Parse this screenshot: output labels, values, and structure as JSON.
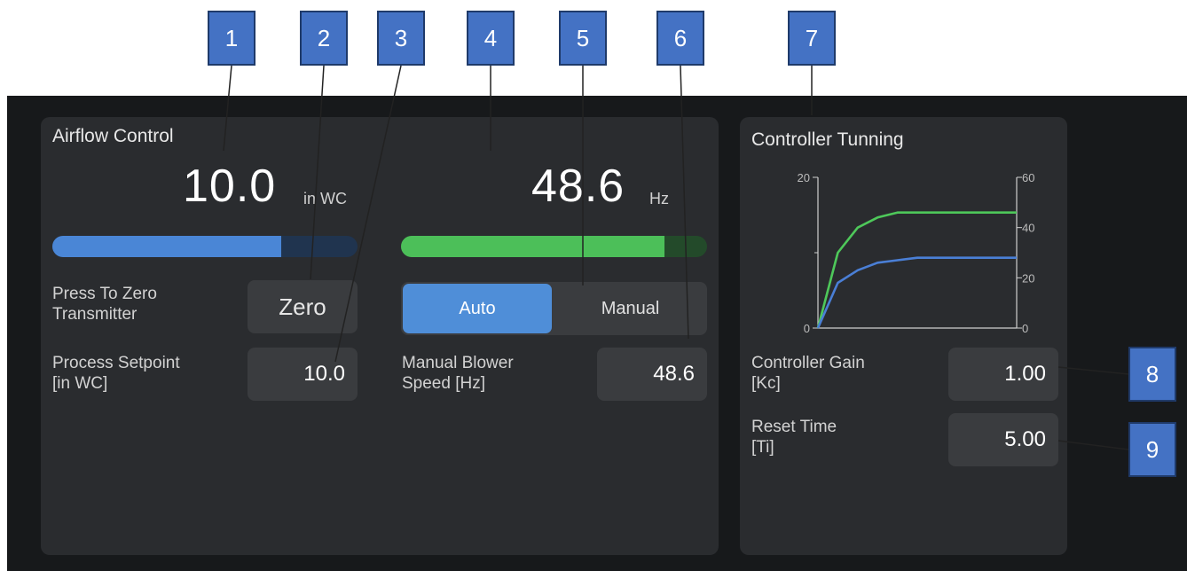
{
  "airflow": {
    "title": "Airflow Control",
    "pressure_value": "10.0",
    "pressure_unit": "in WC",
    "pressure_level": 0.75,
    "blower_value": "48.6",
    "blower_unit": "Hz",
    "blower_level": 0.86,
    "zero_label": "Press To Zero Transmitter",
    "zero_button": "Zero",
    "mode_auto": "Auto",
    "mode_manual": "Manual",
    "mode_selected": "Auto",
    "setpoint_label_1": "Process Setpoint",
    "setpoint_label_2": "[in WC]",
    "setpoint_value": "10.0",
    "manual_speed_label_1": "Manual Blower",
    "manual_speed_label_2": "Speed [Hz]",
    "manual_speed_value": "48.6"
  },
  "tuning": {
    "title": "Controller Tunning",
    "gain_label_1": "Controller Gain",
    "gain_label_2": "[Kc]",
    "gain_value": "1.00",
    "reset_label_1": "Reset Time",
    "reset_label_2": "[Ti]",
    "reset_value": "5.00"
  },
  "chart_data": {
    "type": "line",
    "left_axis": {
      "ticks": [
        "20",
        "0"
      ],
      "range": [
        0,
        20
      ]
    },
    "right_axis": {
      "ticks": [
        "60",
        "40",
        "20",
        "0"
      ],
      "range": [
        0,
        60
      ]
    },
    "series": [
      {
        "color": "#4ec85a",
        "axis": "right",
        "x": [
          0,
          1,
          2,
          3,
          4,
          5,
          6,
          7,
          8,
          9,
          10
        ],
        "y": [
          0,
          30,
          40,
          44,
          46,
          46,
          46,
          46,
          46,
          46,
          46
        ]
      },
      {
        "color": "#4a7fd6",
        "axis": "right",
        "x": [
          0,
          1,
          2,
          3,
          4,
          5,
          6,
          7,
          8,
          9,
          10
        ],
        "y": [
          0,
          18,
          23,
          26,
          27,
          28,
          28,
          28,
          28,
          28,
          28
        ]
      }
    ]
  },
  "callouts": [
    "1",
    "2",
    "3",
    "4",
    "5",
    "6",
    "7",
    "8",
    "9"
  ],
  "colors": {
    "pressure_bar": "#4a86d6",
    "pressure_track": "#20344f",
    "blower_bar": "#4cbf59",
    "blower_track": "#234a2a",
    "auto_active": "#4f8ed8",
    "callout": "#4472c4"
  }
}
